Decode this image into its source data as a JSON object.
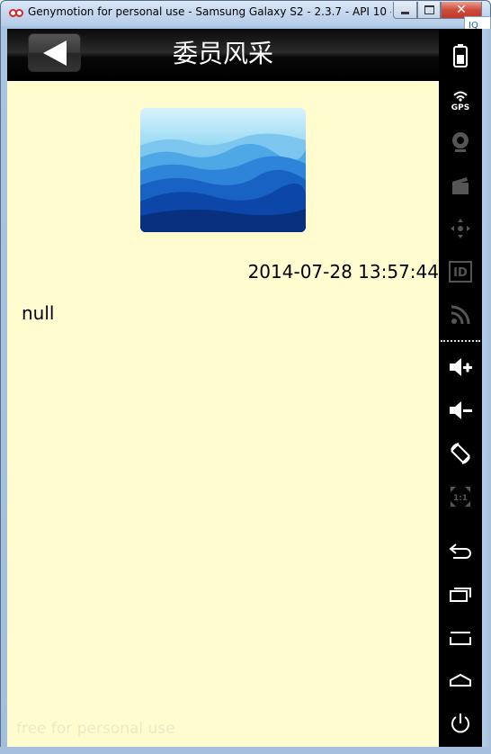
{
  "window": {
    "title": "Genymotion for personal use - Samsung Galaxy S2 - 2.3.7 - API 10 - ...",
    "controls": {
      "minimize": "",
      "maximize": "",
      "close": "✕"
    },
    "side_tab_label": "IQ"
  },
  "header": {
    "title": "委员风采"
  },
  "article": {
    "timestamp": "2014-07-28 13:57:44",
    "content": "null"
  },
  "footer": {
    "watermark": "free for personal use"
  },
  "toolbar": {
    "items": [
      {
        "icon": "battery-icon",
        "enabled": true
      },
      {
        "icon": "gps-icon",
        "label": "GPS",
        "enabled": true
      },
      {
        "icon": "webcam-icon",
        "enabled": false
      },
      {
        "icon": "screencast-icon",
        "enabled": false
      },
      {
        "icon": "remote-control-icon",
        "enabled": false
      },
      {
        "icon": "id-icon",
        "label": "ID",
        "enabled": false
      },
      {
        "icon": "network-icon",
        "enabled": false
      },
      {
        "icon": "volume-up-icon",
        "enabled": true
      },
      {
        "icon": "volume-down-icon",
        "enabled": true
      },
      {
        "icon": "rotate-icon",
        "enabled": true
      },
      {
        "icon": "pixel-perfect-icon",
        "label": "1:1",
        "enabled": false
      },
      {
        "icon": "back-icon",
        "enabled": true
      },
      {
        "icon": "recent-apps-icon",
        "enabled": true
      },
      {
        "icon": "menu-icon",
        "enabled": true
      },
      {
        "icon": "home-icon",
        "enabled": true
      },
      {
        "icon": "power-icon",
        "enabled": true
      }
    ]
  },
  "colors": {
    "screen_background": "#fffdd0",
    "actionbar": "#000000",
    "toolbar": "#000000",
    "toolbar_icon_active": "#ffffff",
    "toolbar_icon_disabled": "#555555"
  }
}
